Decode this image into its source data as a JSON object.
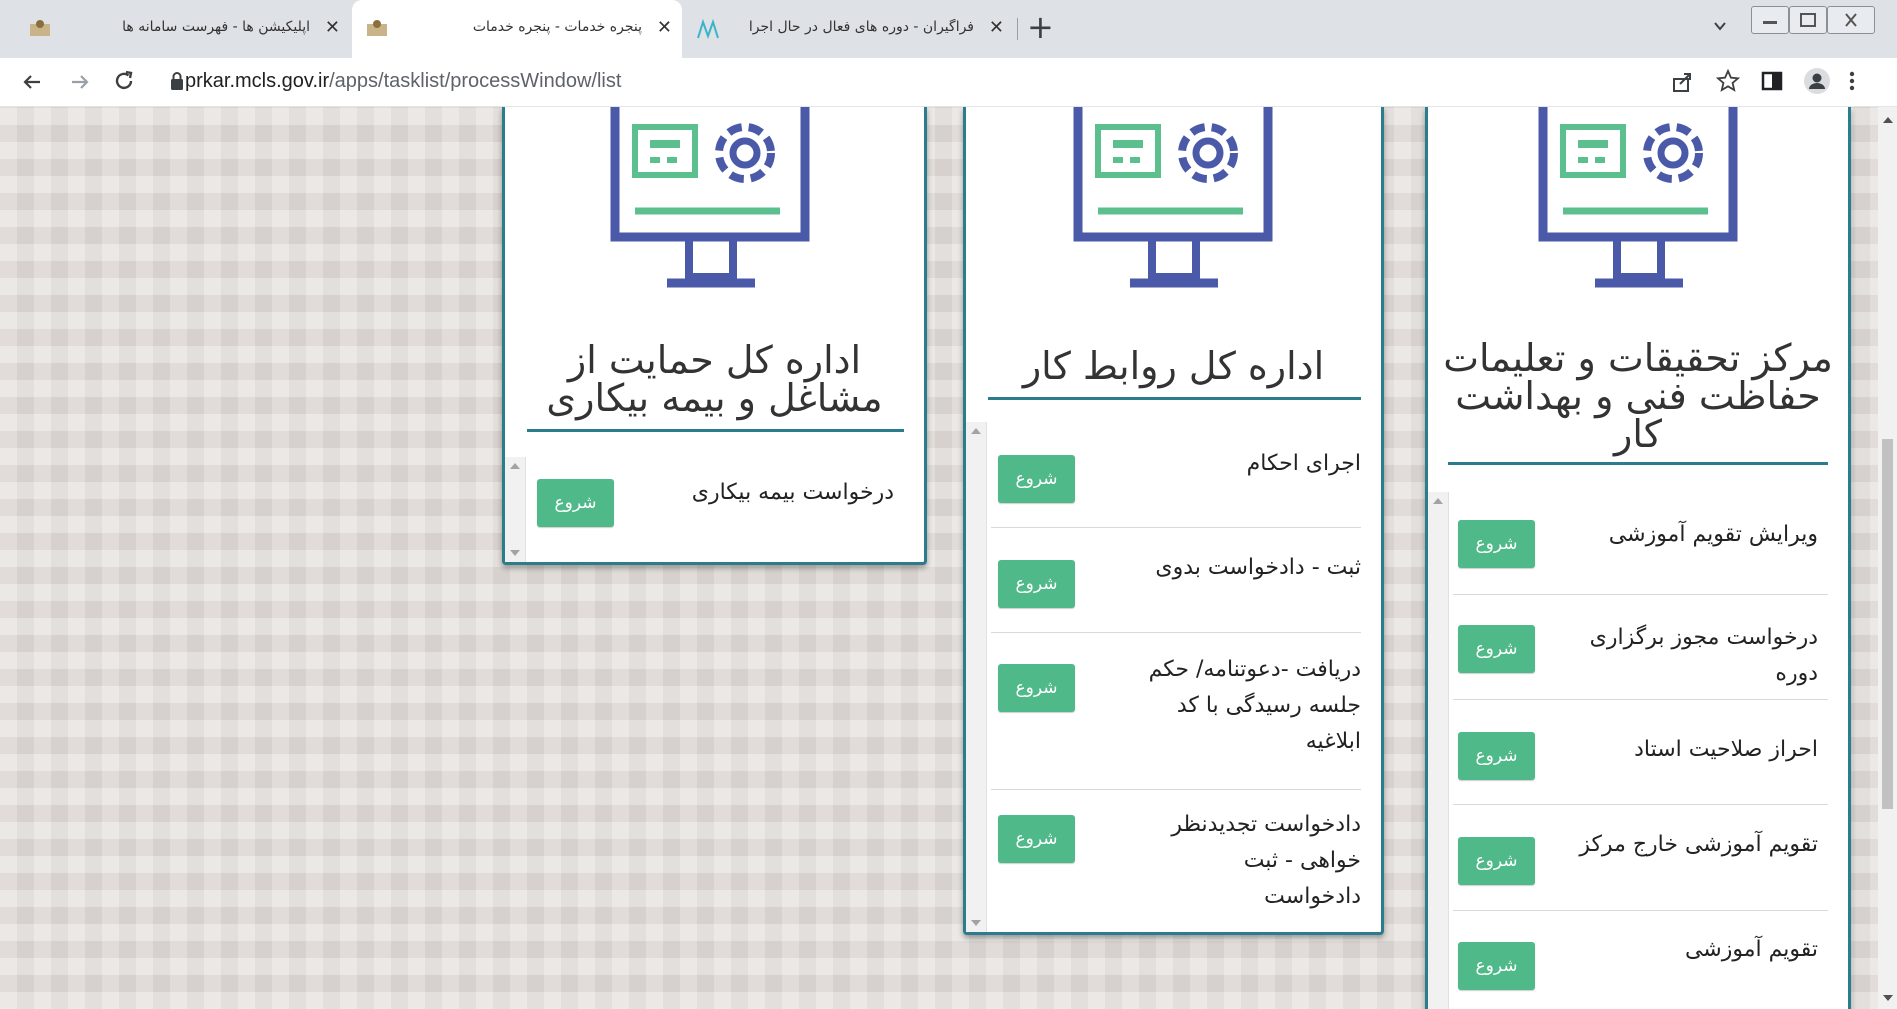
{
  "browser": {
    "tabs": [
      {
        "title": "اپلیکیشن ها - فهرست سامانه ها",
        "active": false
      },
      {
        "title": "پنجره خدمات - پنجره خدمات",
        "active": true
      },
      {
        "title": "فراگیران - دوره های فعال در حال اجرا",
        "active": false
      }
    ],
    "close_glyph": "✕",
    "new_tab_glyph": "+",
    "url_host": "prkar.mcls.gov.ir",
    "url_path": "/apps/tasklist/processWindow/list"
  },
  "cards": [
    {
      "title_line1": "مرکز تحقیقات و تعلیمات",
      "title_line2": "حفاظت فنی و بهداشت",
      "title_line3": "کار",
      "items": [
        {
          "label_line1": "ویرایش تقویم آموزشی",
          "label_line2": "",
          "button": "شروع"
        },
        {
          "label_line1": "درخواست مجوز برگزاری",
          "label_line2": "دوره",
          "button": "شروع"
        },
        {
          "label_line1": "احراز صلاحیت استاد",
          "label_line2": "",
          "button": "شروع"
        },
        {
          "label_line1": "تقویم آموزشی خارج مرکز",
          "label_line2": "",
          "button": "شروع"
        },
        {
          "label_line1": "تقویم آموزشی",
          "label_line2": "",
          "button": "شروع"
        }
      ]
    },
    {
      "title_line1": "اداره کل روابط کار",
      "items": [
        {
          "label_line1": "اجرای احکام",
          "button": "شروع"
        },
        {
          "label_line1": "ثبت - دادخواست بدوی",
          "button": "شروع"
        },
        {
          "label_line1": "دریافت -دعوتنامه/ حکم",
          "label_line2": "جلسه رسیدگی با کد",
          "label_line3": "ابلاغیه",
          "button": "شروع"
        },
        {
          "label_line1": "دادخواست تجدیدنظر",
          "label_line2": "خواهی - ثبت",
          "label_line3": "دادخواست",
          "button": "شروع"
        }
      ]
    },
    {
      "title_line1": "اداره کل حمایت از",
      "title_line2": "مشاغل و بیمه بیکاری",
      "items": [
        {
          "label_line1": "درخواست بیمه بیکاری",
          "button": "شروع"
        }
      ]
    }
  ],
  "colors": {
    "accent": "#2b7d8e",
    "button": "#4fb989",
    "icon_blue": "#4a5aa8",
    "icon_green": "#5cc08e"
  }
}
